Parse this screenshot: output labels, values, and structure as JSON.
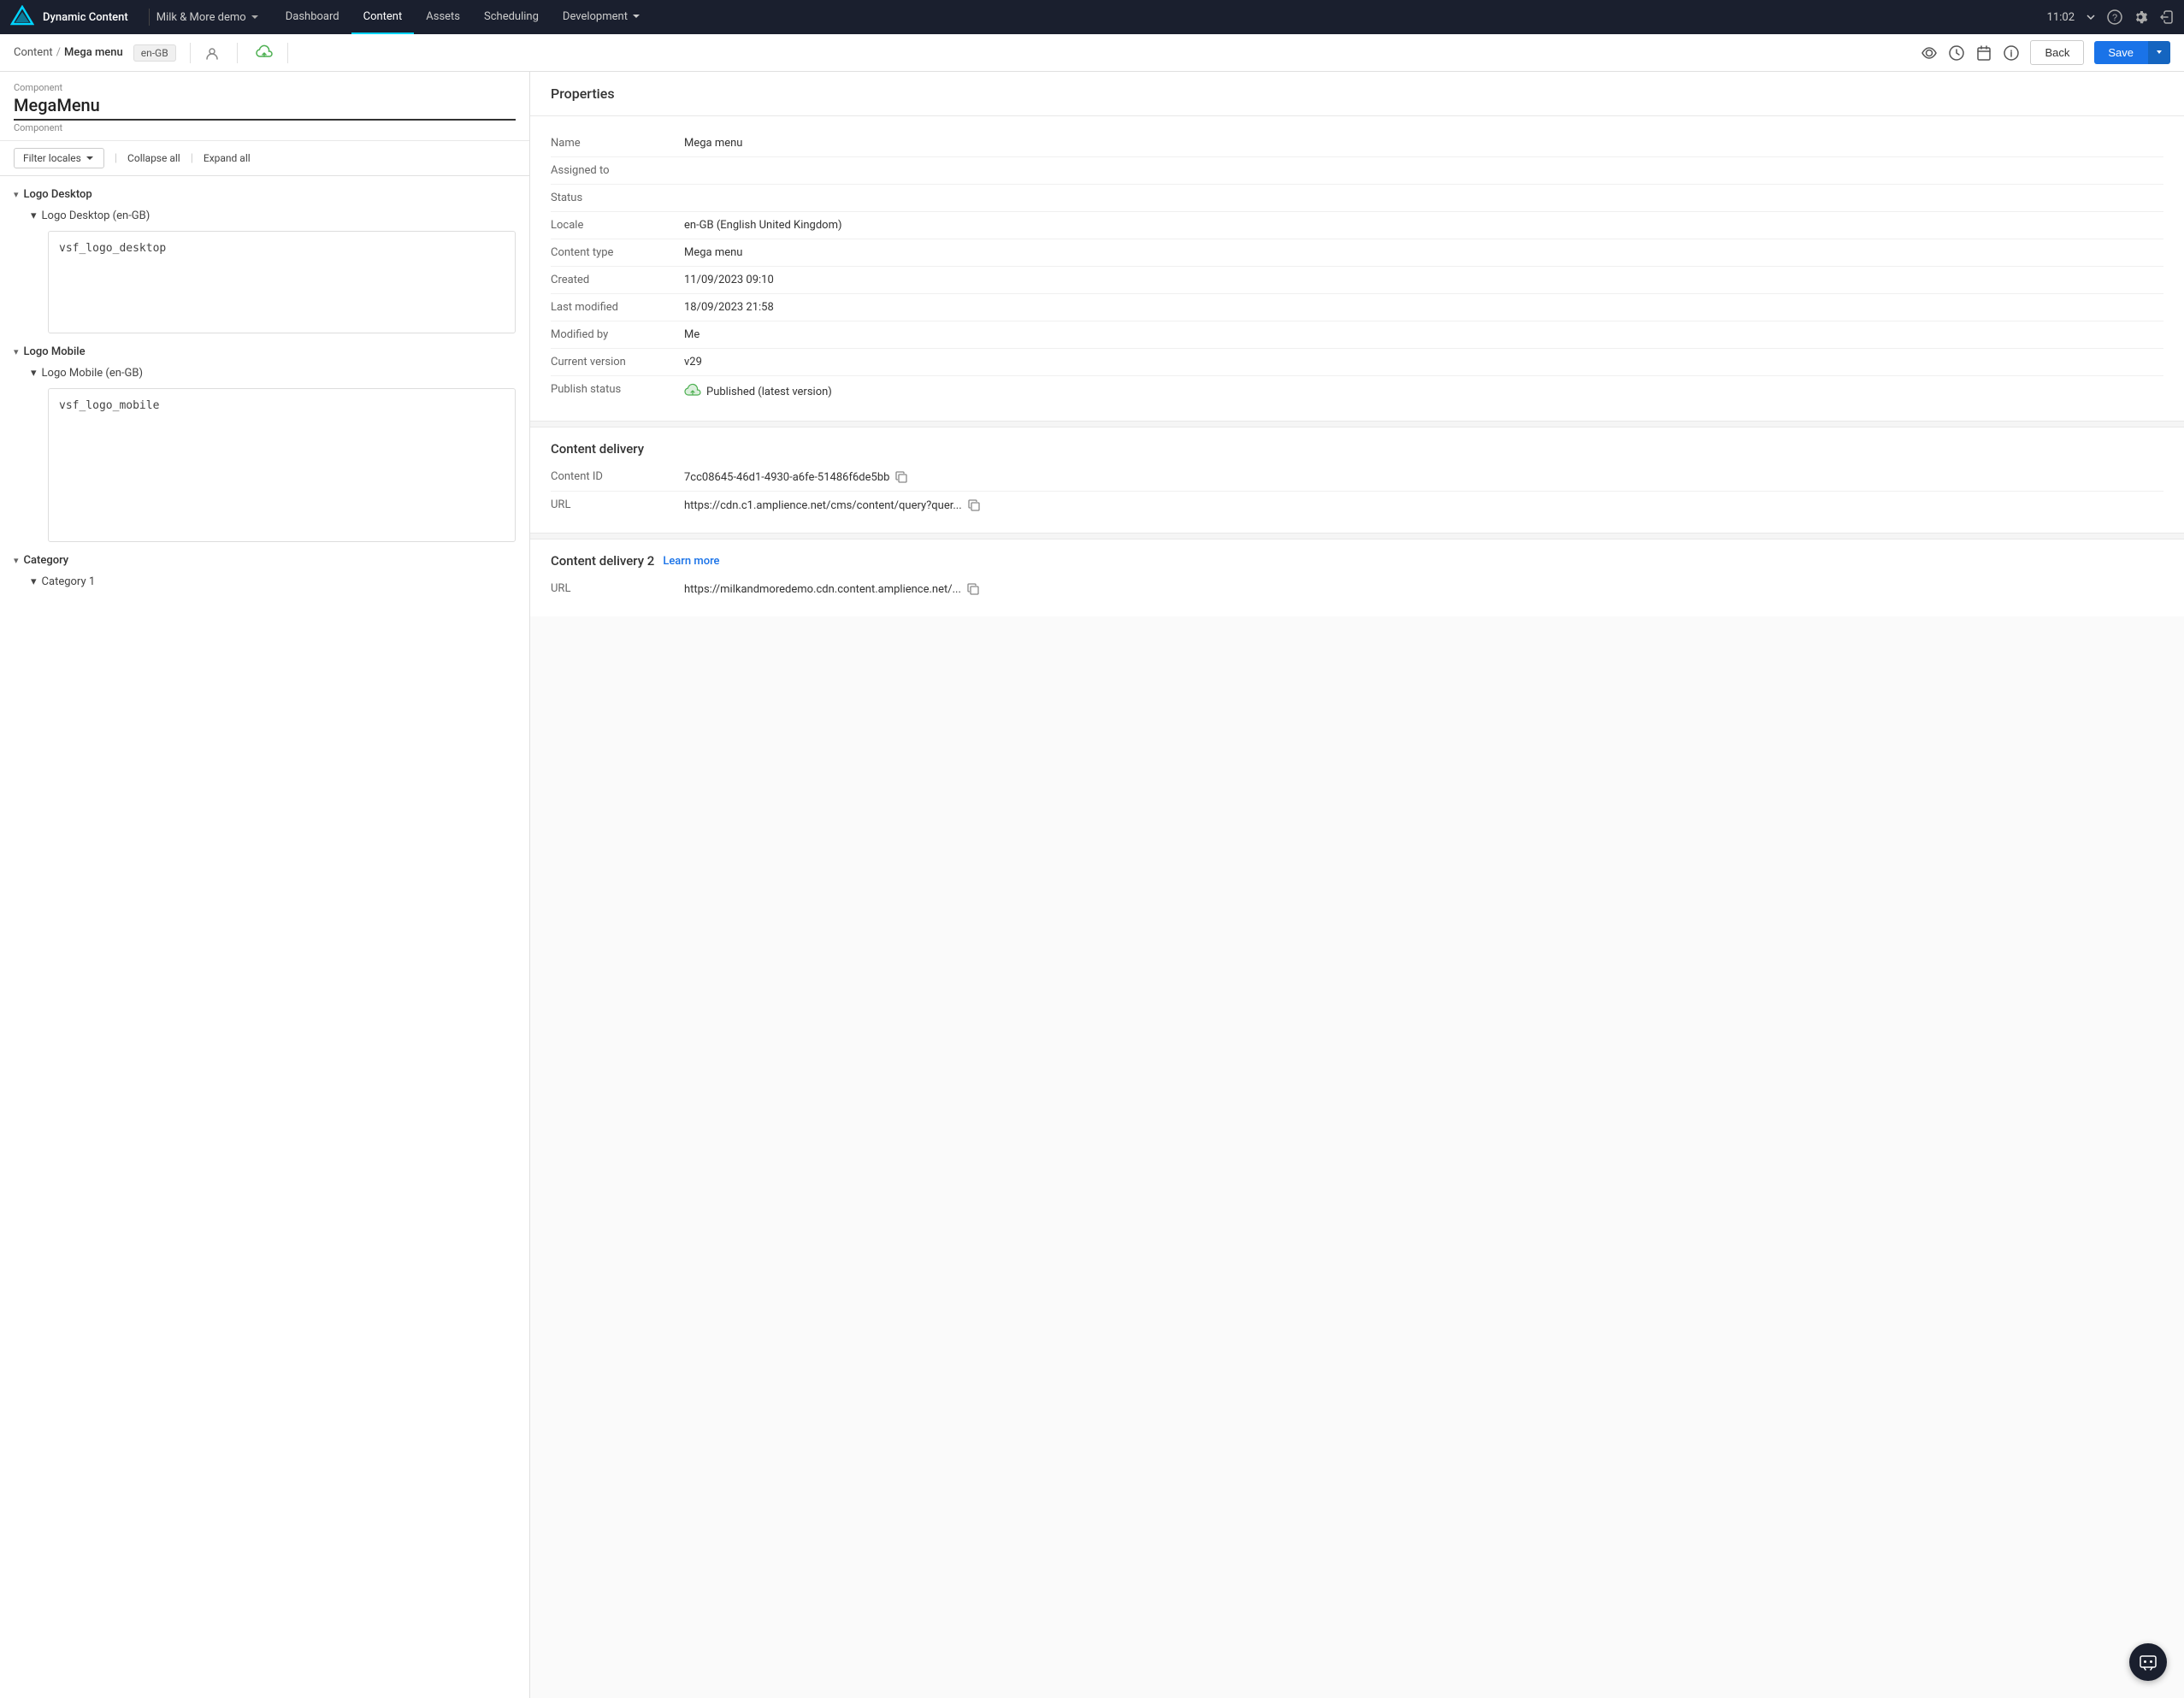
{
  "app": {
    "name": "Dynamic Content",
    "workspace": "Milk & More demo",
    "time": "11:02"
  },
  "nav": {
    "links": [
      {
        "id": "dashboard",
        "label": "Dashboard",
        "active": false
      },
      {
        "id": "content",
        "label": "Content",
        "active": true
      },
      {
        "id": "assets",
        "label": "Assets",
        "active": false
      },
      {
        "id": "scheduling",
        "label": "Scheduling",
        "active": false
      },
      {
        "id": "development",
        "label": "Development",
        "active": false,
        "hasArrow": true
      }
    ]
  },
  "sub_header": {
    "breadcrumb_root": "Content",
    "breadcrumb_sep": "/",
    "breadcrumb_current": "Mega menu",
    "locale": "en-GB",
    "back_label": "Back",
    "save_label": "Save"
  },
  "left_panel": {
    "component_label": "Component",
    "component_name": "MegaMenu",
    "component_type": "Component",
    "filter_locales_label": "Filter locales",
    "collapse_all_label": "Collapse all",
    "expand_all_label": "Expand all",
    "sections": [
      {
        "id": "logo-desktop",
        "label": "Logo Desktop",
        "expanded": true,
        "sub_sections": [
          {
            "id": "logo-desktop-en-gb",
            "label": "Logo Desktop (en-GB)",
            "expanded": true,
            "content": "vsf_logo_desktop"
          }
        ]
      },
      {
        "id": "logo-mobile",
        "label": "Logo Mobile",
        "expanded": true,
        "sub_sections": [
          {
            "id": "logo-mobile-en-gb",
            "label": "Logo Mobile (en-GB)",
            "expanded": true,
            "content": "vsf_logo_mobile"
          }
        ]
      },
      {
        "id": "category",
        "label": "Category",
        "expanded": true,
        "sub_sections": [
          {
            "id": "category-1",
            "label": "Category 1",
            "expanded": false,
            "content": ""
          }
        ]
      }
    ]
  },
  "properties": {
    "header": "Properties",
    "rows": [
      {
        "label": "Name",
        "value": "Mega menu",
        "type": "text"
      },
      {
        "label": "Assigned to",
        "value": "",
        "type": "text"
      },
      {
        "label": "Status",
        "value": "",
        "type": "text"
      },
      {
        "label": "Locale",
        "value": "en-GB (English United Kingdom)",
        "type": "text"
      },
      {
        "label": "Content type",
        "value": "Mega menu",
        "type": "text"
      },
      {
        "label": "Created",
        "value": "11/09/2023 09:10",
        "type": "text"
      },
      {
        "label": "Last modified",
        "value": "18/09/2023 21:58",
        "type": "text"
      },
      {
        "label": "Modified by",
        "value": "Me",
        "type": "text"
      },
      {
        "label": "Current version",
        "value": "v29",
        "type": "text"
      },
      {
        "label": "Publish status",
        "value": "Published (latest version)",
        "type": "publish"
      }
    ],
    "content_delivery": {
      "header": "Content delivery",
      "content_id_label": "Content ID",
      "content_id_value": "7cc08645-46d1-4930-a6fe-51486f6de5bb",
      "url_label": "URL",
      "url_value": "https://cdn.c1.amplience.net/cms/content/query?quer..."
    },
    "content_delivery2": {
      "header": "Content delivery 2",
      "learn_more": "Learn more",
      "url_label": "URL",
      "url_value": "https://milkandmoredemo.cdn.content.amplience.net/..."
    }
  }
}
